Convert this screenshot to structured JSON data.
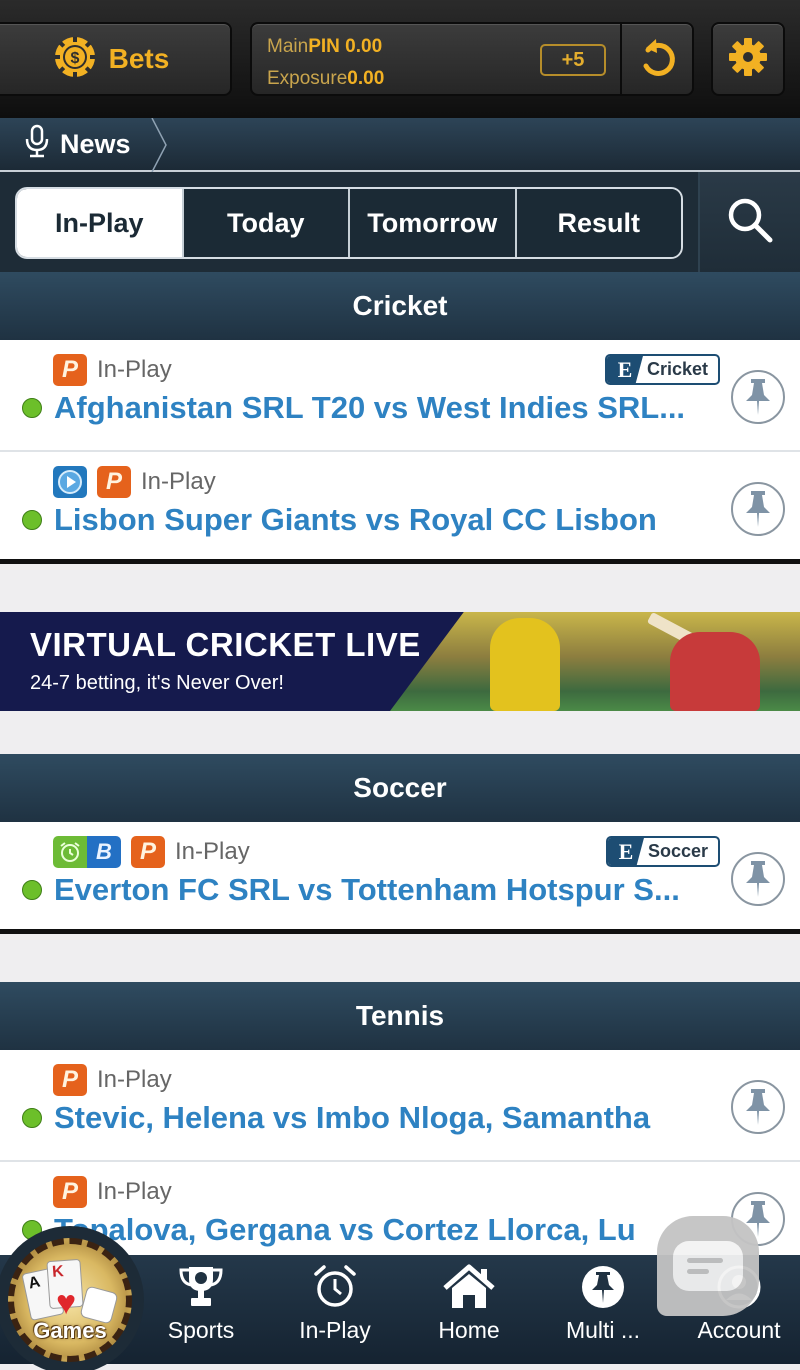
{
  "topbar": {
    "bets_label": "Bets",
    "main_label": "Main",
    "main_currency": "PIN",
    "main_value": "0.00",
    "exposure_label": "Exposure",
    "exposure_value": "0.00",
    "plus_badge": "+5",
    "icons": {
      "bets": "coin-chip-icon",
      "refresh": "refresh-icon",
      "settings": "gear-icon"
    },
    "accent_color": "#f2b123"
  },
  "newsbar": {
    "label": "News",
    "icon": "microphone-icon"
  },
  "tabs": {
    "items": [
      {
        "label": "In-Play",
        "active": true
      },
      {
        "label": "Today",
        "active": false
      },
      {
        "label": "Tomorrow",
        "active": false
      },
      {
        "label": "Result",
        "active": false
      }
    ],
    "search_icon": "search-icon"
  },
  "sections": [
    {
      "title": "Cricket",
      "events": [
        {
          "badges": [
            "P"
          ],
          "status": "In-Play",
          "title": "Afghanistan SRL T20 vs West Indies SRL...",
          "esport_badge": {
            "letter": "E",
            "label": "Cricket"
          },
          "live": true
        },
        {
          "badges": [
            "play",
            "P"
          ],
          "status": "In-Play",
          "title": "Lisbon Super Giants vs Royal CC Lisbon",
          "live": true
        }
      ]
    },
    {
      "title": "Soccer",
      "events": [
        {
          "badges": [
            "alarm-B",
            "P"
          ],
          "status": "In-Play",
          "title": "Everton FC SRL vs Tottenham Hotspur S...",
          "esport_badge": {
            "letter": "E",
            "label": "Soccer"
          },
          "live": true
        }
      ]
    },
    {
      "title": "Tennis",
      "events": [
        {
          "badges": [
            "P"
          ],
          "status": "In-Play",
          "title": "Stevic, Helena vs Imbo Nloga, Samantha",
          "live": true
        },
        {
          "badges": [
            "P"
          ],
          "status": "In-Play",
          "title": "Topalova, Gergana vs Cortez Llorca, Lu",
          "live": true
        }
      ]
    }
  ],
  "banner": {
    "headline": "VIRTUAL CRICKET LIVE",
    "subline": "24-7 betting, it's Never Over!"
  },
  "bottomnav": {
    "games_label": "Games",
    "card_a": "A",
    "card_k": "K",
    "items": [
      {
        "label": "Sports",
        "icon": "trophy-icon"
      },
      {
        "label": "In-Play",
        "icon": "alarm-clock-icon"
      },
      {
        "label": "Home",
        "icon": "home-icon"
      },
      {
        "label": "Multi ...",
        "icon": "pin-icon"
      },
      {
        "label": "Account",
        "icon": "account-icon"
      }
    ]
  },
  "chat": {
    "icon": "chat-bubble-icon"
  }
}
